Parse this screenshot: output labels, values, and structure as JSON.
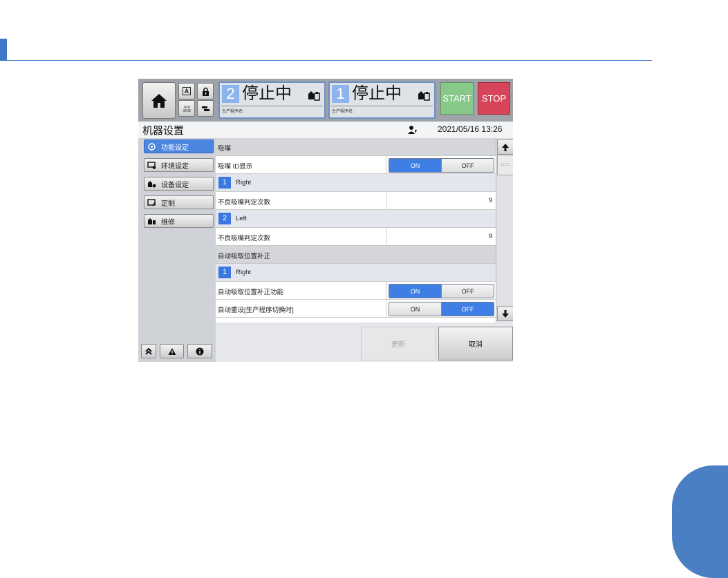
{
  "topbar": {
    "status_1": {
      "number": "2",
      "text": "停止中",
      "program_label": "生产程序名:"
    },
    "status_2": {
      "number": "1",
      "text": "停止中",
      "program_label": "生产程序名:"
    },
    "start_label": "START",
    "stop_label": "STOP",
    "small_button_a_label": "A"
  },
  "titlebar": {
    "title": "机器设置",
    "datetime": "2021/05/16 13:26"
  },
  "nav": {
    "items": [
      {
        "label": "功能设定",
        "icon": "function-settings-icon",
        "active": true
      },
      {
        "label": "环境设定",
        "icon": "environment-settings-icon",
        "active": false
      },
      {
        "label": "设备设定",
        "icon": "device-settings-icon",
        "active": false
      },
      {
        "label": "定制",
        "icon": "custom-icon",
        "active": false
      },
      {
        "label": "维修",
        "icon": "maintenance-icon",
        "active": false
      }
    ]
  },
  "rows": {
    "nozzle_header": "吸嘴",
    "nozzle_id_display": {
      "label": "吸嘴 ID显示",
      "on": "ON",
      "off": "OFF",
      "state": "ON"
    },
    "right_1": {
      "badge": "1",
      "label": "Right"
    },
    "bad_count_1": {
      "label": "不良吸嘴判定次数",
      "value": "9"
    },
    "left_2": {
      "badge": "2",
      "label": "Left"
    },
    "bad_count_2": {
      "label": "不良吸嘴判定次数",
      "value": "9"
    },
    "auto_pickup_header": "自动吸取位置补正",
    "right_3": {
      "badge": "1",
      "label": "Right"
    },
    "auto_pickup_func": {
      "label": "自动吸取位置补正功能",
      "on": "ON",
      "off": "OFF",
      "state": "ON"
    },
    "auto_reset": {
      "label": "自动重设[生产程序切换时]",
      "on": "ON",
      "off": "OFF",
      "state": "OFF"
    }
  },
  "footer": {
    "update_label": "更新",
    "cancel_label": "取消"
  },
  "colors": {
    "accent": "#3f7fe5",
    "start": "#88c98a",
    "stop": "#d8455a",
    "page_accent": "#3f78c6"
  }
}
